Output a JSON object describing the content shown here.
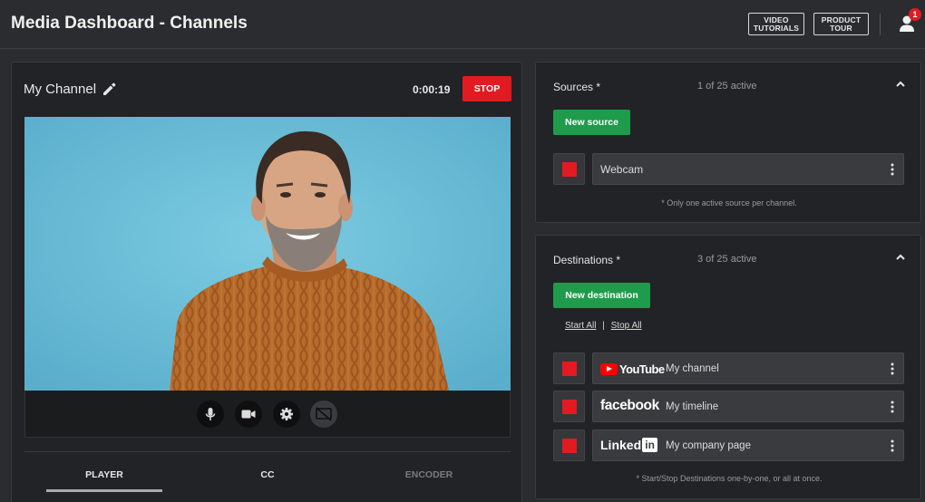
{
  "header": {
    "title": "Media Dashboard - Channels",
    "video_tutorials_label": "VIDEO\nTUTORIALS",
    "product_tour_label": "PRODUCT\nTOUR",
    "notification_count": "1"
  },
  "channel": {
    "name": "My Channel",
    "timer": "0:00:19",
    "stop_label": "STOP",
    "tabs": [
      {
        "label": "PLAYER",
        "active": true
      },
      {
        "label": "CC",
        "active": false
      },
      {
        "label": "ENCODER",
        "active": false
      }
    ],
    "controls": [
      "microphone-icon",
      "camera-icon",
      "settings-icon",
      "screen-off-icon"
    ]
  },
  "sources": {
    "title": "Sources *",
    "count": "1 of 25 active",
    "new_button": "New source",
    "items": [
      {
        "label": "Webcam"
      }
    ],
    "note": "* Only one active source per channel."
  },
  "destinations": {
    "title": "Destinations *",
    "count": "3 of 25 active",
    "new_button": "New destination",
    "start_all": "Start All",
    "separator": "|",
    "stop_all": "Stop All",
    "items": [
      {
        "platform": "YouTube",
        "logo_text": "YouTube",
        "label": "My channel"
      },
      {
        "platform": "facebook",
        "logo_text": "facebook",
        "label": "My timeline"
      },
      {
        "platform": "LinkedIn",
        "logo_text": "Linked",
        "logo_box": "in",
        "label": "My company page"
      }
    ],
    "note": "* Start/Stop Destinations one-by-one, or all at once."
  },
  "colors": {
    "background": "#2b2c2f",
    "panel": "#222326",
    "stop_red": "#e21b23",
    "action_green": "#1e9c4b",
    "video_bg": "#6bbcd6"
  }
}
